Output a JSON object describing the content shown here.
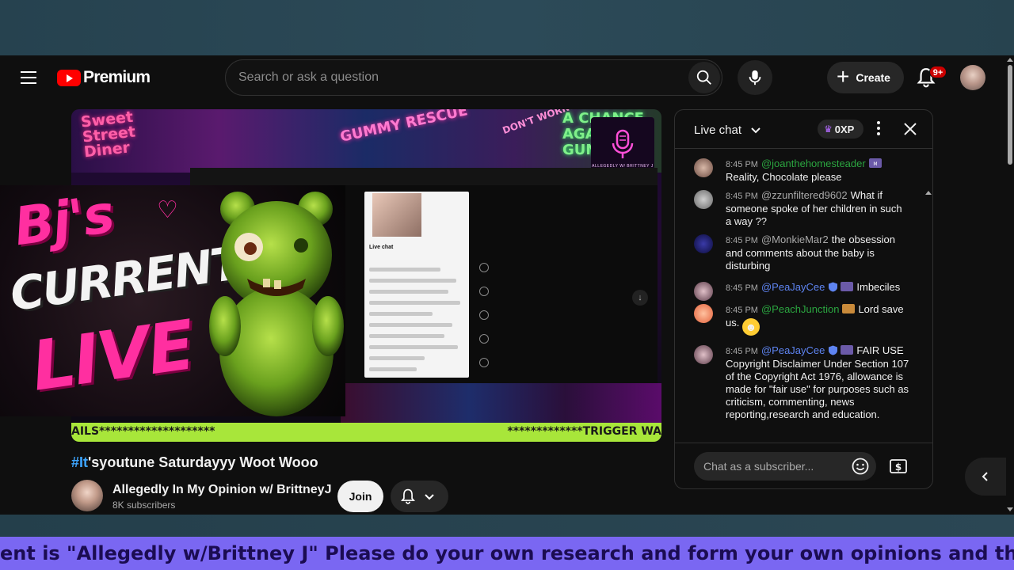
{
  "masthead": {
    "logo_text": "Premium",
    "search_placeholder": "Search or ask a question",
    "create_label": "Create",
    "notif_count": "9+"
  },
  "video": {
    "banner": {
      "left_sign": "Sweet\nStreet\nDiner",
      "center_sign": "GUMMY RESCUE",
      "right_sign": "A CHANCE\nAGAIN\nGUM",
      "small_sign": "DON'T WORRY"
    },
    "podcast_caption": "ALLEGEDLY W/ BRITTNEY J",
    "overlay": {
      "line1": "Bj's",
      "line2": "CURRENT",
      "line3": "LIVE"
    },
    "inner_chat_title": "Live chat",
    "strip_left": "AILS********************",
    "strip_right": "*************TRIGGER WA"
  },
  "title": {
    "hashtag": "#It",
    "rest": "'syoutune Saturdayyy Woot Wooo"
  },
  "channel": {
    "name": "Allegedly In My Opinion w/ BrittneyJ",
    "subscribers": "8K subscribers",
    "join_label": "Join"
  },
  "chat": {
    "title": "Live chat",
    "xp": "0XP",
    "input_placeholder": "Chat as a subscriber...",
    "messages": [
      {
        "time": "8:45 PM",
        "author": "@joanthehomesteader",
        "text": "Reality, Chocolate please"
      },
      {
        "time": "8:45 PM",
        "author": "@zzunfiltered9602",
        "text": "What if someone spoke of her children in such a way ??"
      },
      {
        "time": "8:45 PM",
        "author": "@MonkieMar2",
        "text": "the obsession and comments about the baby is disturbing"
      },
      {
        "time": "8:45 PM",
        "author": "@PeaJayCee",
        "text": "Imbeciles"
      },
      {
        "time": "8:45 PM",
        "author": "@PeachJunction",
        "text": "Lord save us."
      },
      {
        "time": "8:45 PM",
        "author": "@PeaJayCee",
        "text": "FAIR USE Copyright Disclaimer Under Section 107 of the Copyright Act 1976, allowance is made for \"fair use\" for purposes such as criticism, commenting, news reporting,research and education."
      }
    ]
  },
  "ticker": {
    "text": "ent is \"Allegedly w/Brittney J\" Please do your own research and form your own opinions and thank you for b"
  },
  "colors": {
    "accent_red": "#ff0000",
    "link_blue": "#3ea6ff",
    "author_green": "#2ba640",
    "ticker_bg": "#7a67f2"
  }
}
